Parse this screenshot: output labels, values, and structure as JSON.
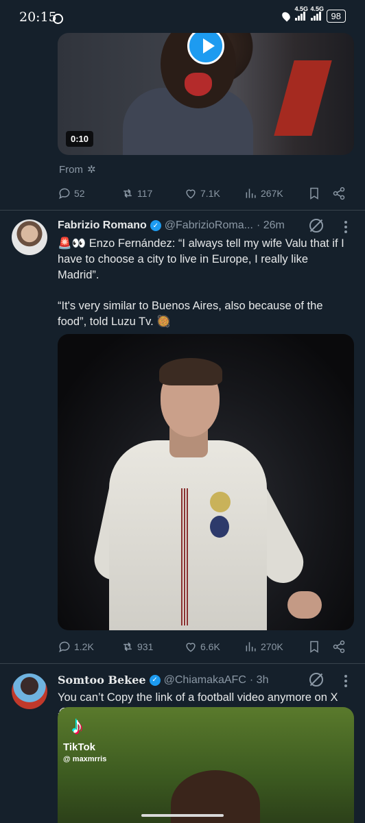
{
  "status_bar": {
    "time": "20:15",
    "net1": "4.5G",
    "net2": "4.5G",
    "battery": "98"
  },
  "tweet1": {
    "video_duration": "0:10",
    "from_label": "From",
    "actions": {
      "replies": "52",
      "reposts": "117",
      "likes": "7.1K",
      "views": "267K"
    }
  },
  "tweet2": {
    "name": "Fabrizio Romano",
    "handle": "@FabrizioRoma...",
    "time": "· 26m",
    "emoji": "🚨👀",
    "text_line1": "Enzo Fernández: “I always tell my wife Valu that if I have to choose a city to live in Europe, I really like Madrid”.",
    "text_line2": "“It's very similar to Buenos Aires, also because of the food”, told Luzu Tv. 🥘",
    "actions": {
      "replies": "1.2K",
      "reposts": "931",
      "likes": "6.6K",
      "views": "270K"
    }
  },
  "tweet3": {
    "name": "Somtoo Bekee",
    "handle": "@ChiamakaAFC",
    "time": "· 3h",
    "text": "You can’t Copy the link of a football video anymore on X 😭😭💔",
    "media": {
      "brand": "TikTok",
      "username": "@ maxmrris"
    }
  }
}
